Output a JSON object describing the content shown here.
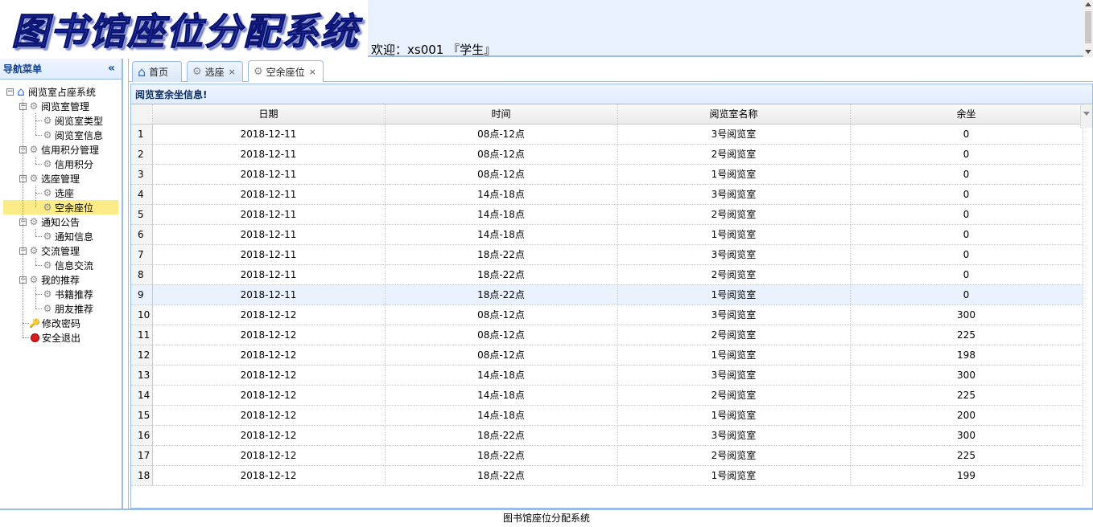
{
  "header": {
    "logo_text": "图书馆座位分配系统",
    "welcome": "欢迎：xs001 『学生』"
  },
  "sidebar": {
    "title": "导航菜单",
    "collapse_icon": "«",
    "tree": {
      "root": "阅览室占座系统",
      "groups": [
        {
          "label": "阅览室管理",
          "children": [
            "阅览室类型",
            "阅览室信息"
          ]
        },
        {
          "label": "信用积分管理",
          "children": [
            "信用积分"
          ]
        },
        {
          "label": "选座管理",
          "children": [
            "选座",
            "空余座位"
          ]
        },
        {
          "label": "通知公告",
          "children": [
            "通知信息"
          ]
        },
        {
          "label": "交流管理",
          "children": [
            "信息交流"
          ]
        },
        {
          "label": "我的推荐",
          "children": [
            "书籍推荐",
            "朋友推荐"
          ]
        }
      ],
      "extra": [
        "修改密码",
        "安全退出"
      ],
      "selected": "空余座位"
    }
  },
  "tabs": [
    {
      "label": "首页",
      "icon": "home-icon",
      "closable": false
    },
    {
      "label": "选座",
      "icon": "gear-icon",
      "closable": true
    },
    {
      "label": "空余座位",
      "icon": "gear-icon",
      "closable": true,
      "active": true
    }
  ],
  "grid": {
    "title": "阅览室余坐信息!",
    "columns": [
      "日期",
      "时间",
      "阅览室名称",
      "余坐"
    ],
    "rows": [
      [
        "1",
        "2018-12-11",
        "08点-12点",
        "3号阅览室",
        "0"
      ],
      [
        "2",
        "2018-12-11",
        "08点-12点",
        "2号阅览室",
        "0"
      ],
      [
        "3",
        "2018-12-11",
        "08点-12点",
        "1号阅览室",
        "0"
      ],
      [
        "4",
        "2018-12-11",
        "14点-18点",
        "3号阅览室",
        "0"
      ],
      [
        "5",
        "2018-12-11",
        "14点-18点",
        "2号阅览室",
        "0"
      ],
      [
        "6",
        "2018-12-11",
        "14点-18点",
        "1号阅览室",
        "0"
      ],
      [
        "7",
        "2018-12-11",
        "18点-22点",
        "3号阅览室",
        "0"
      ],
      [
        "8",
        "2018-12-11",
        "18点-22点",
        "2号阅览室",
        "0"
      ],
      [
        "9",
        "2018-12-11",
        "18点-22点",
        "1号阅览室",
        "0"
      ],
      [
        "10",
        "2018-12-12",
        "08点-12点",
        "3号阅览室",
        "300"
      ],
      [
        "11",
        "2018-12-12",
        "08点-12点",
        "2号阅览室",
        "225"
      ],
      [
        "12",
        "2018-12-12",
        "08点-12点",
        "1号阅览室",
        "198"
      ],
      [
        "13",
        "2018-12-12",
        "14点-18点",
        "3号阅览室",
        "300"
      ],
      [
        "14",
        "2018-12-12",
        "14点-18点",
        "2号阅览室",
        "225"
      ],
      [
        "15",
        "2018-12-12",
        "14点-18点",
        "1号阅览室",
        "200"
      ],
      [
        "16",
        "2018-12-12",
        "18点-22点",
        "3号阅览室",
        "300"
      ],
      [
        "17",
        "2018-12-12",
        "18点-22点",
        "2号阅览室",
        "225"
      ],
      [
        "18",
        "2018-12-12",
        "18点-22点",
        "1号阅览室",
        "199"
      ]
    ],
    "highlight_row": 9
  },
  "footer": {
    "text": "图书馆座位分配系统"
  },
  "colors": {
    "border": "#99bbe8",
    "selected": "#fbec88",
    "header_text": "#15428b"
  }
}
